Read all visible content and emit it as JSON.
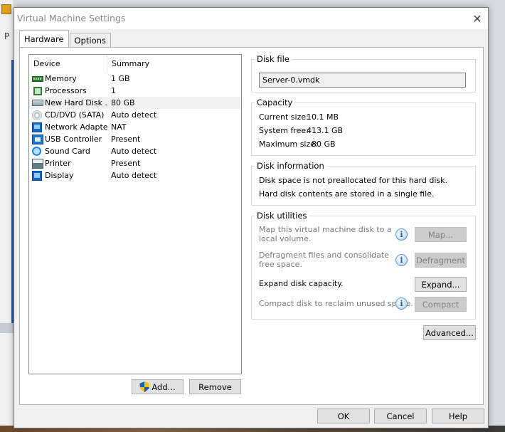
{
  "background": {
    "letter": "P"
  },
  "window": {
    "title": "Virtual Machine Settings",
    "close_glyph": "✕"
  },
  "tabs": [
    {
      "label": "Hardware",
      "active": true
    },
    {
      "label": "Options",
      "active": false
    }
  ],
  "device_list": {
    "headers": {
      "device": "Device",
      "summary": "Summary"
    },
    "rows": [
      {
        "device": "Memory",
        "summary": "1 GB",
        "icon": "memory-icon"
      },
      {
        "device": "Processors",
        "summary": "1",
        "icon": "processor-icon"
      },
      {
        "device": "New Hard Disk ...",
        "summary": "80 GB",
        "icon": "hard-disk-icon",
        "selected": true
      },
      {
        "device": "CD/DVD (SATA)",
        "summary": "Auto detect",
        "icon": "cd-dvd-icon"
      },
      {
        "device": "Network Adapter",
        "summary": "NAT",
        "icon": "network-adapter-icon"
      },
      {
        "device": "USB Controller",
        "summary": "Present",
        "icon": "usb-controller-icon"
      },
      {
        "device": "Sound Card",
        "summary": "Auto detect",
        "icon": "sound-card-icon"
      },
      {
        "device": "Printer",
        "summary": "Present",
        "icon": "printer-icon"
      },
      {
        "device": "Display",
        "summary": "Auto detect",
        "icon": "display-icon"
      }
    ],
    "add_label": "Add...",
    "remove_label": "Remove"
  },
  "disk_file": {
    "title": "Disk file",
    "value": "Server-0.vmdk"
  },
  "capacity": {
    "title": "Capacity",
    "current_label": "Current size:",
    "current_value": "10.1 MB",
    "free_label": "System free:",
    "free_value": "413.1 GB",
    "max_label": "Maximum size:",
    "max_value": "80 GB"
  },
  "disk_information": {
    "title": "Disk information",
    "line1": "Disk space is not preallocated for this hard disk.",
    "line2": "Hard disk contents are stored in a single file."
  },
  "disk_utilities": {
    "title": "Disk utilities",
    "map_text": "Map this virtual machine disk to a local volume.",
    "map_button": "Map...",
    "defrag_text": "Defragment files and consolidate free space.",
    "defrag_button": "Defragment",
    "expand_text": "Expand disk capacity.",
    "expand_button": "Expand...",
    "compact_text": "Compact disk to reclaim unused space.",
    "compact_button": "Compact"
  },
  "advanced_label": "Advanced...",
  "footer": {
    "ok": "OK",
    "cancel": "Cancel",
    "help": "Help"
  }
}
